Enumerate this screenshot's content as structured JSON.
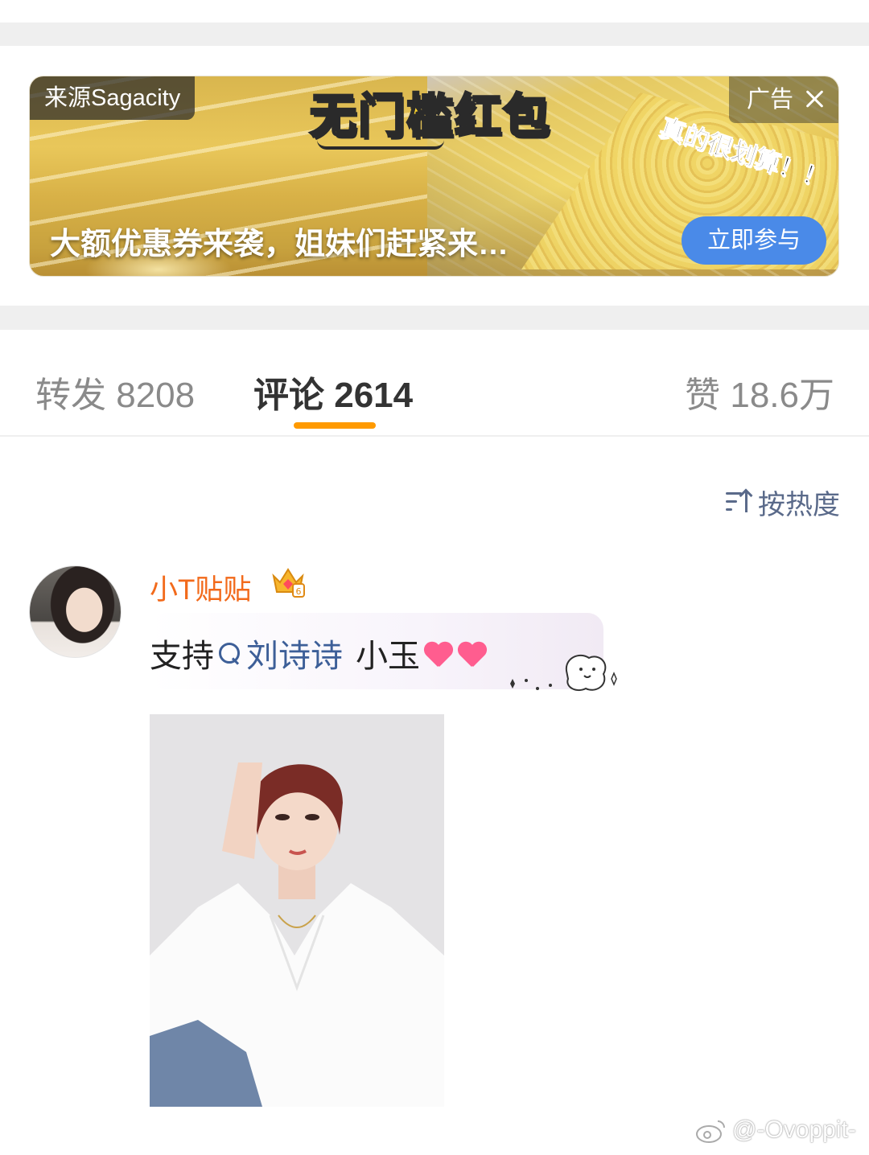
{
  "ad": {
    "source": "来源Sagacity",
    "label": "广告",
    "headline": "无门槛红包",
    "sticker": "真的很划算！！",
    "caption": "大额优惠券来袭，姐妹们赶紧来…",
    "cta": "立即参与"
  },
  "tabs": {
    "forward": "转发 8208",
    "comment": "评论 2614",
    "like": "赞 18.6万"
  },
  "sort": {
    "label": "按热度"
  },
  "comment": {
    "username": "小T贴贴",
    "text_prefix": "支持",
    "mention": "刘诗诗",
    "text_suffix": "小玉"
  },
  "watermark": "@-Ovoppit-",
  "colors": {
    "accent_orange": "#ff9a00",
    "username": "#f26a1b",
    "link_blue": "#3d5f98",
    "cta_blue": "#4a8ae8"
  },
  "icons": [
    "close-icon",
    "sort-icon",
    "crown-badge-icon",
    "search-topic-icon",
    "heart-emoji-icon",
    "weibo-logo-icon"
  ]
}
